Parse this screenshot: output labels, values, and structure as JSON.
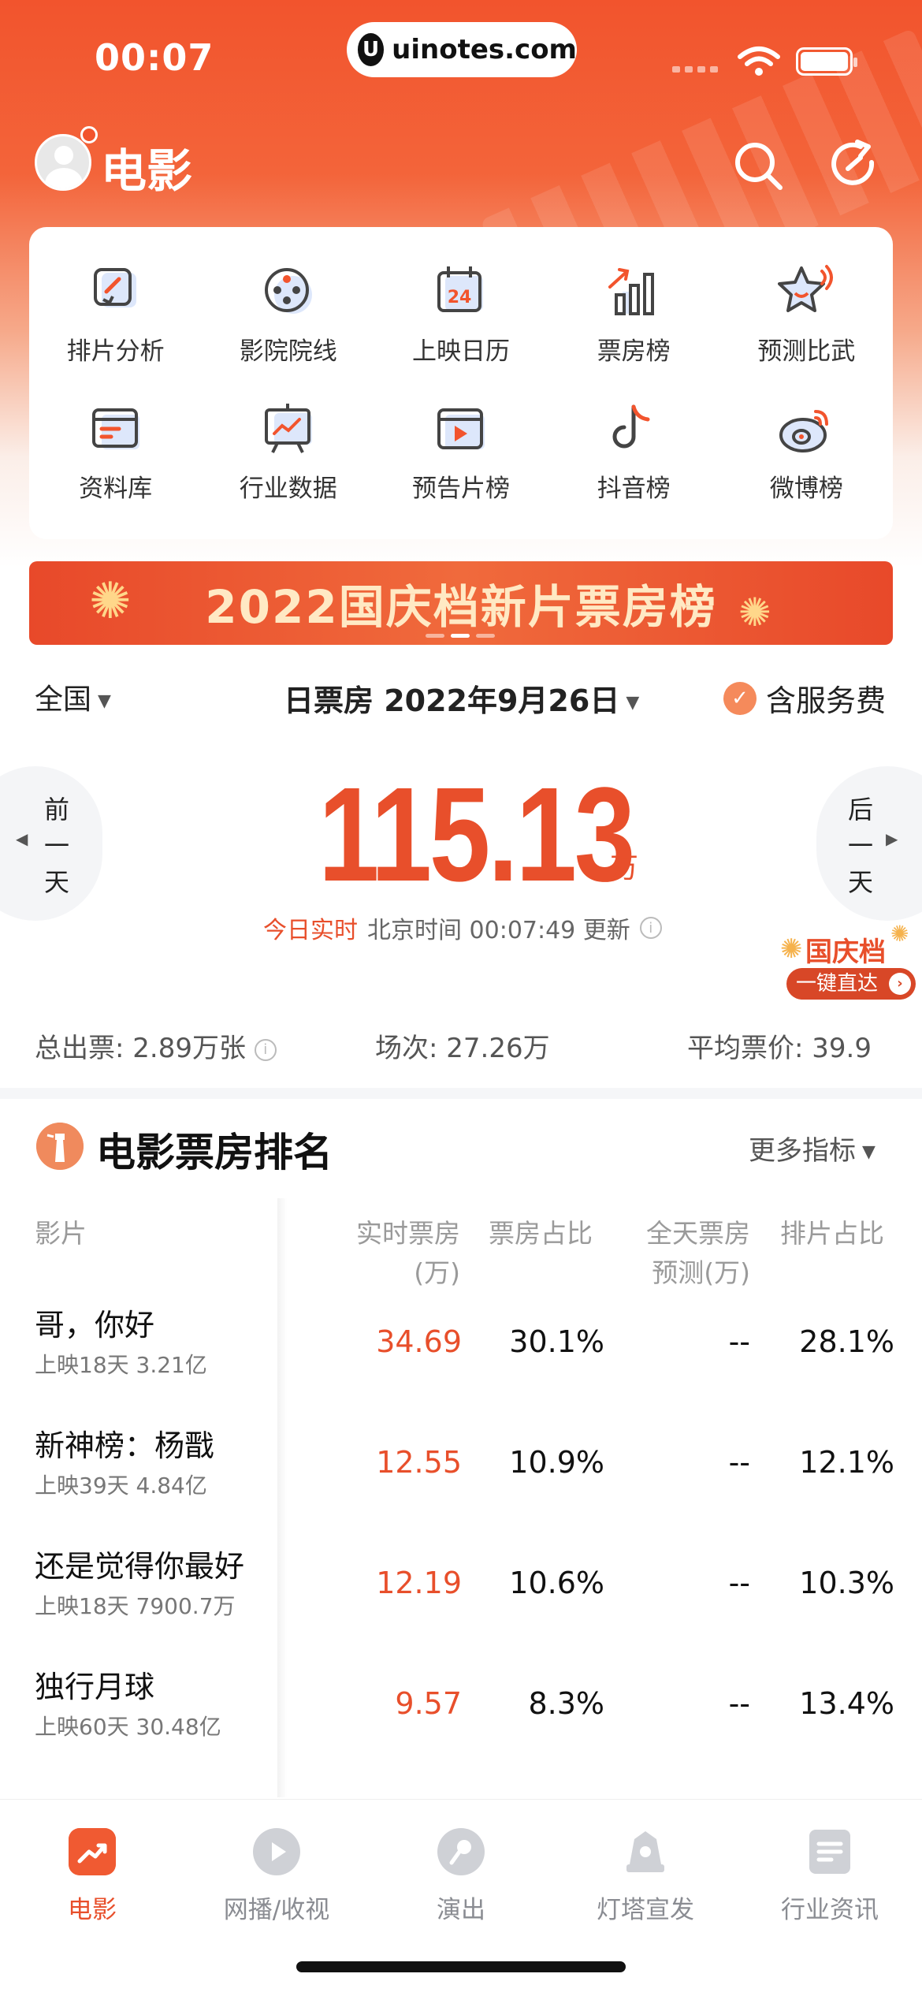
{
  "status": {
    "time": "00:07",
    "url": "uinotes.com",
    "url_logo": "U"
  },
  "header": {
    "title": "电影"
  },
  "colors": {
    "brand": "#f2542d",
    "accent": "#e84f2b"
  },
  "grid": [
    {
      "label": "排片分析",
      "icon": "schedule-analysis-icon"
    },
    {
      "label": "影院院线",
      "icon": "cinema-chain-icon"
    },
    {
      "label": "上映日历",
      "icon": "release-calendar-icon"
    },
    {
      "label": "票房榜",
      "icon": "box-office-chart-icon"
    },
    {
      "label": "预测比武",
      "icon": "prediction-icon"
    },
    {
      "label": "资料库",
      "icon": "database-icon"
    },
    {
      "label": "行业数据",
      "icon": "industry-data-icon"
    },
    {
      "label": "预告片榜",
      "icon": "trailer-icon"
    },
    {
      "label": "抖音榜",
      "icon": "douyin-icon"
    },
    {
      "label": "微博榜",
      "icon": "weibo-icon"
    }
  ],
  "calendar_day": "24",
  "banner": {
    "text": "2022国庆档新片票房榜"
  },
  "filters": {
    "region": "全国",
    "date": "日票房 2022年9月26日",
    "service_fee": "含服务费",
    "service_fee_checked": true
  },
  "box_office": {
    "prev_day": [
      "前",
      "一",
      "天"
    ],
    "next_day": [
      "后",
      "一",
      "天"
    ],
    "value": "115.13",
    "unit": "万",
    "live_label": "今日实时",
    "update_text": "北京时间 00:07:49 更新",
    "holiday_badge": "国庆档",
    "holiday_link": "一键直达"
  },
  "stats": {
    "tickets": "总出票: 2.89万张",
    "shows": "场次: 27.26万",
    "avg_price": "平均票价: 39.9"
  },
  "ranking": {
    "title": "电影票房排名",
    "more": "更多指标",
    "headers": {
      "film": "影片",
      "realtime_1": "实时票房",
      "realtime_2": "(万)",
      "share": "票房占比",
      "forecast_1": "全天票房",
      "forecast_2": "预测(万)",
      "screening": "排片占比"
    },
    "rows": [
      {
        "name": "哥，你好",
        "sub": "上映18天 3.21亿",
        "realtime": "34.69",
        "share": "30.1%",
        "forecast": "--",
        "screening": "28.1%"
      },
      {
        "name": "新神榜：杨戬",
        "sub": "上映39天 4.84亿",
        "realtime": "12.55",
        "share": "10.9%",
        "forecast": "--",
        "screening": "12.1%"
      },
      {
        "name": "还是觉得你最好",
        "sub": "上映18天 7900.7万",
        "realtime": "12.19",
        "share": "10.6%",
        "forecast": "--",
        "screening": "10.3%"
      },
      {
        "name": "独行月球",
        "sub": "上映60天 30.48亿",
        "realtime": "9.57",
        "share": "8.3%",
        "forecast": "--",
        "screening": "13.4%"
      }
    ]
  },
  "tabs": [
    {
      "label": "电影",
      "icon": "movie-tab-icon",
      "active": true
    },
    {
      "label": "网播/收视",
      "icon": "streaming-tab-icon",
      "active": false
    },
    {
      "label": "演出",
      "icon": "performance-tab-icon",
      "active": false
    },
    {
      "label": "灯塔宣发",
      "icon": "lighthouse-tab-icon",
      "active": false
    },
    {
      "label": "行业资讯",
      "icon": "news-tab-icon",
      "active": false
    }
  ]
}
